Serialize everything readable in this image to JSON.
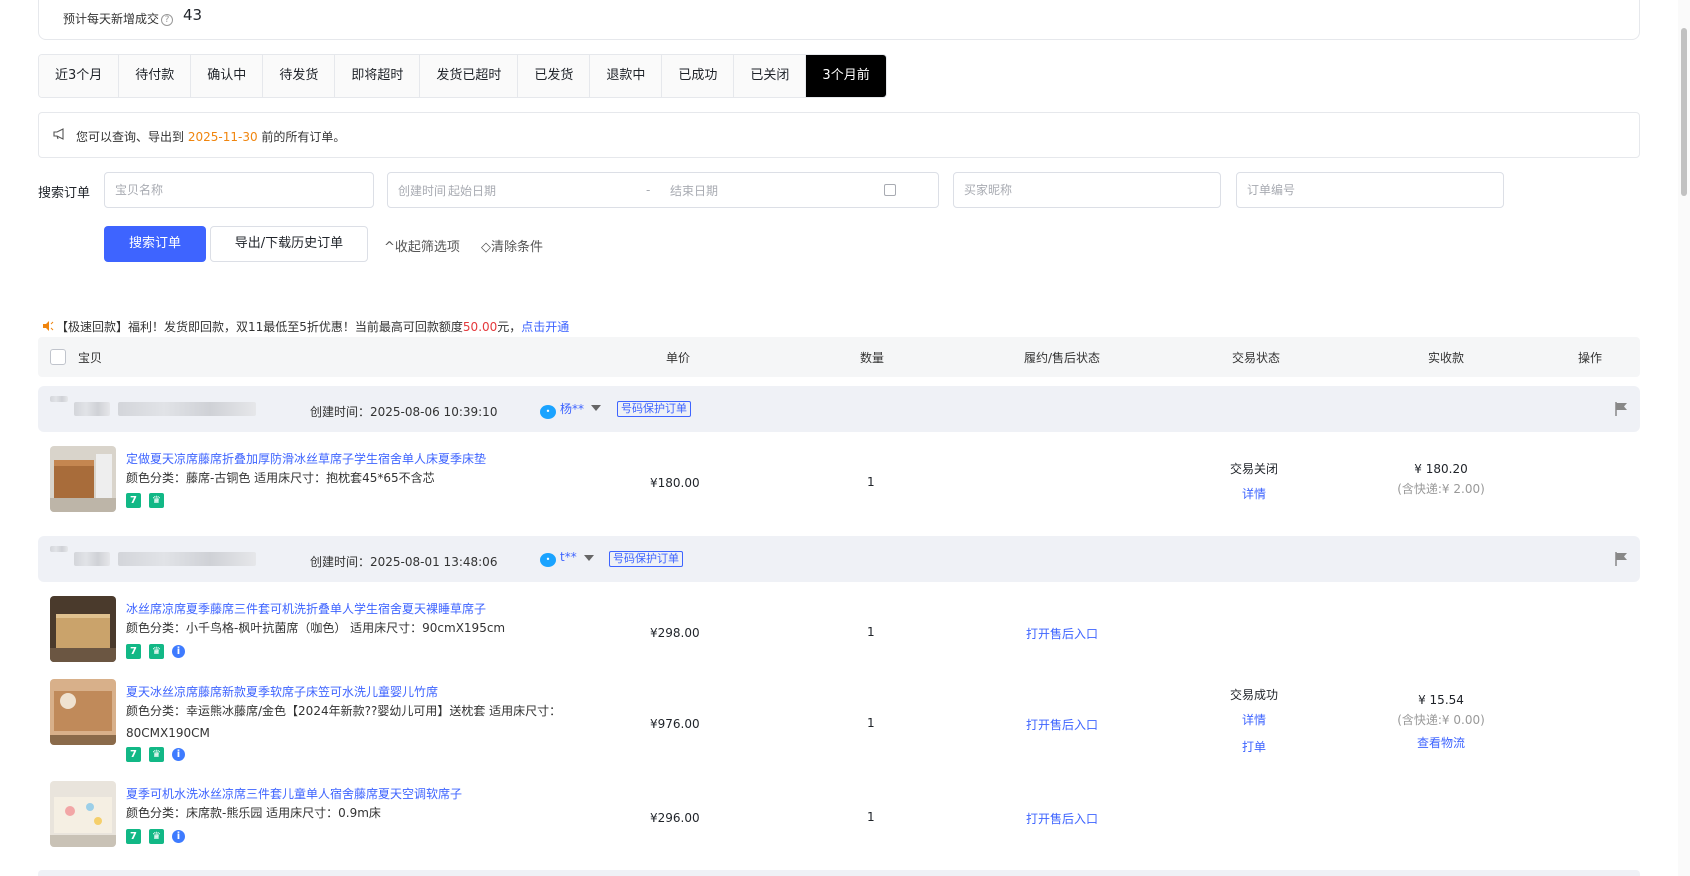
{
  "top_card": {
    "label": "预计每天新增成交",
    "value": "43"
  },
  "tabs": [
    "近3个月",
    "待付款",
    "确认中",
    "待发货",
    "即将超时",
    "发货已超时",
    "已发货",
    "退款中",
    "已成功",
    "已关闭",
    "3个月前"
  ],
  "active_tab": "3个月前",
  "notice": {
    "prefix": "您可以查询、导出到",
    "date": "2025-11-30",
    "suffix": "前的所有订单。"
  },
  "search": {
    "label": "搜索订单",
    "item_name_placeholder": "宝贝名称",
    "created_time_label": "创建时间",
    "start_date_placeholder": "起始日期",
    "date_separator": "-",
    "end_date_placeholder": "结束日期",
    "buyer_placeholder": "买家昵称",
    "order_no_placeholder": "订单编号",
    "search_button": "搜索订单",
    "export_button": "导出/下载历史订单",
    "collapse_filters": "收起筛选项",
    "clear_conditions": "清除条件"
  },
  "promo": {
    "text": "【极速回款】福利！发货即回款，双11最低至5折优惠！当前最高可回款额度",
    "amount": "50.00",
    "unit": "元，",
    "link": "点击开通"
  },
  "table_header": {
    "item": "宝贝",
    "unit_price": "单价",
    "quantity": "数量",
    "fulfillment": "履约/售后状态",
    "trade_status": "交易状态",
    "received": "实收款",
    "action": "操作"
  },
  "orders": [
    {
      "created_time": "创建时间：2025-08-06 10:39:10",
      "buyer": "杨**",
      "protect_tag": "号码保护订单",
      "status": "交易关闭",
      "detail_link": "详情",
      "amount": "¥ 180.20",
      "shipping_fee": "(含快递:¥ 2.00)",
      "items": [
        {
          "title": "定做夏天凉席藤席折叠加厚防滑冰丝草席子学生宿舍单人床夏季床垫",
          "sku": "颜色分类：藤席-古铜色   适用床尺寸：抱枕套45*65不含芯",
          "price": "¥180.00",
          "qty": "1"
        }
      ]
    },
    {
      "created_time": "创建时间：2025-08-01 13:48:06",
      "buyer": "t**",
      "protect_tag": "号码保护订单",
      "status": "交易成功",
      "detail_link": "详情",
      "print_link": "打单",
      "amount": "¥ 15.54",
      "shipping_fee": "(含快递:¥ 0.00)",
      "logistics_link": "查看物流",
      "items": [
        {
          "title": "冰丝席凉席夏季藤席三件套可机洗折叠单人学生宿舍夏天裸睡草席子",
          "sku": "颜色分类：小千鸟格-枫叶抗菌席（咖色）   适用床尺寸：90cmX195cm",
          "price": "¥298.00",
          "qty": "1",
          "after_sale": "打开售后入口"
        },
        {
          "title": "夏天冰丝凉席藤席新款夏季软席子床笠可水洗儿童婴儿竹席",
          "sku": "颜色分类：幸运熊冰藤席/金色【2024年新款??婴幼儿可用】送枕套   适用床尺寸：80CMX190CM",
          "price": "¥976.00",
          "qty": "1",
          "after_sale": "打开售后入口"
        },
        {
          "title": "夏季可机水洗冰丝凉席三件套儿童单人宿舍藤席夏天空调软席子",
          "sku": "颜色分类：床席款-熊乐园   适用床尺寸：0.9m床",
          "price": "¥296.00",
          "qty": "1",
          "after_sale": "打开售后入口"
        }
      ]
    }
  ],
  "colors": {
    "primary": "#3e64ff",
    "active_tab_bg": "#000000",
    "highlight_date": "#f0850e",
    "promo_red": "#e4393c",
    "badge_green": "#12b886"
  },
  "icons": {
    "help": "question-circle-icon",
    "notice": "megaphone-icon",
    "promo": "speaker-icon",
    "buyer": "wangwang-icon",
    "filter": "filter-icon",
    "flag": "flag-icon",
    "calendar": "calendar-icon"
  }
}
